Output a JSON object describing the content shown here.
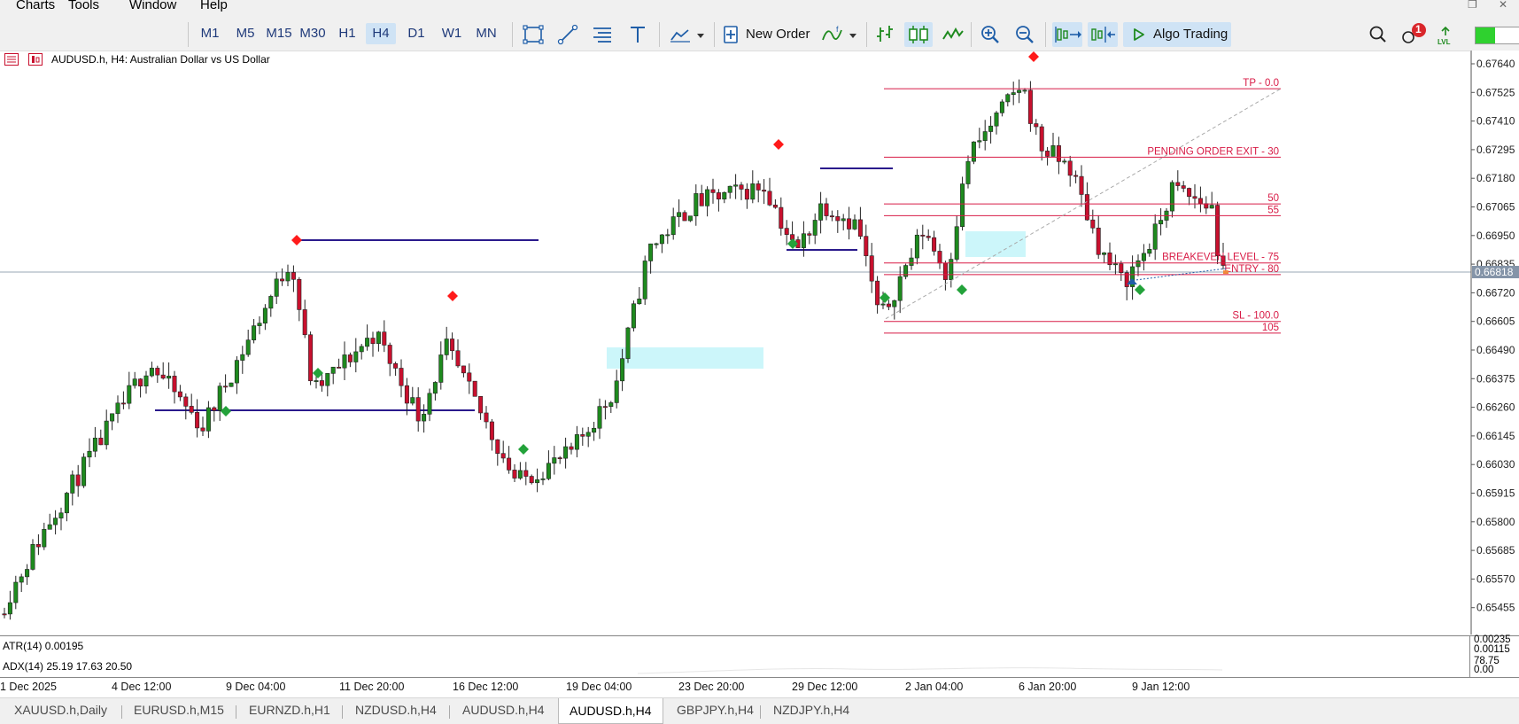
{
  "menu": [
    "Charts",
    "Tools",
    "Window",
    "Help"
  ],
  "toolbar": {
    "timeframes": [
      "M1",
      "M5",
      "M15",
      "M30",
      "H1",
      "H4",
      "D1",
      "W1",
      "MN"
    ],
    "active_timeframe": "H4",
    "new_order_label": "New Order",
    "algo_trading_label": "Algo Trading",
    "notification_count": "1",
    "lvl_label": "LVL"
  },
  "chart": {
    "header": "AUDUSD.h, H4:  Australian Dollar vs US Dollar",
    "price_ticks": [
      "0.67640",
      "0.67525",
      "0.67410",
      "0.67295",
      "0.67180",
      "0.67065",
      "0.66950",
      "0.66835",
      "0.66720",
      "0.66605",
      "0.66490",
      "0.66375",
      "0.66260",
      "0.66145",
      "0.66030",
      "0.65915",
      "0.65800",
      "0.65685",
      "0.65570",
      "0.65455"
    ],
    "current_price": "0.66818",
    "levels": [
      {
        "label": "TP - 0.0",
        "price": 0.6754
      },
      {
        "label": "PENDING ORDER EXIT - 30",
        "price": 0.67265
      },
      {
        "label": "50",
        "price": 0.67077
      },
      {
        "label": "55",
        "price": 0.6703
      },
      {
        "label": "BREAKEVEN LEVEL - 75",
        "price": 0.6684
      },
      {
        "label": "ENTRY - 80",
        "price": 0.66793
      },
      {
        "label": "SL - 100.0",
        "price": 0.66605
      },
      {
        "label": "105",
        "price": 0.66558
      }
    ],
    "colors": {
      "bull": "#1e8a1e",
      "bear": "#c8102e",
      "level": "#d81b46",
      "structure": "#2a1a8c",
      "zone": "#ccf6fa"
    }
  },
  "indicators": {
    "atr_label": "ATR(14) 0.00195",
    "atr_ticks": [
      "0.00235",
      "0.00115"
    ],
    "adx_label": "ADX(14) 25.19 17.63 20.50",
    "adx_ticks": [
      "78.75",
      "0.00"
    ]
  },
  "time_axis": [
    "1 Dec 2025",
    "4 Dec 12:00",
    "9 Dec 04:00",
    "11 Dec 20:00",
    "16 Dec 12:00",
    "19 Dec 04:00",
    "23 Dec 20:00",
    "29 Dec 12:00",
    "2 Jan 04:00",
    "6 Jan 20:00",
    "9 Jan 12:00"
  ],
  "symbol_tabs": [
    "XAUUSD.h,Daily",
    "EURUSD.h,M15",
    "EURNZD.h,H1",
    "NZDUSD.h,H4",
    "AUDUSD.h,H4",
    "AUDUSD.h,H4",
    "GBPJPY.h,H4",
    "NZDJPY.h,H4"
  ],
  "active_tab_index": 5
}
